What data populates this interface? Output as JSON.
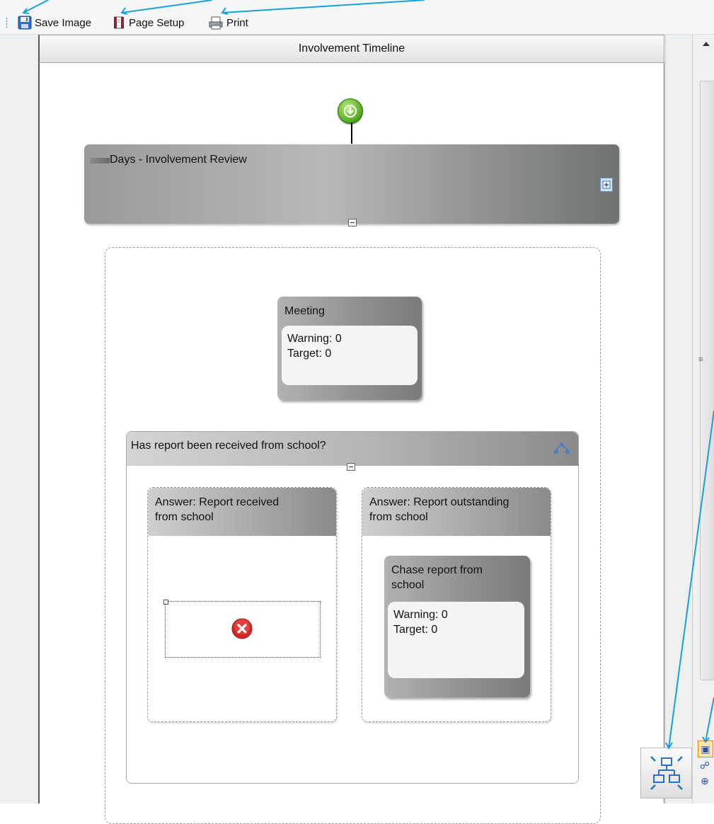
{
  "toolbar": {
    "save_image": "Save Image",
    "page_setup": "Page Setup",
    "print": "Print"
  },
  "canvas": {
    "title": "Involvement Timeline"
  },
  "activity": {
    "label": "Days - Involvement Review"
  },
  "meeting": {
    "title": "Meeting",
    "warning": "Warning: 0",
    "target": "Target: 0"
  },
  "decision": {
    "title": "Has report been received from school?",
    "branches": [
      {
        "line1": "Answer: Report received",
        "line2": "from school"
      },
      {
        "line1": "Answer: Report outstanding",
        "line2": "from school"
      }
    ]
  },
  "chase": {
    "line1": "Chase report from",
    "line2": "school",
    "warning": "Warning: 0",
    "target": "Target: 0"
  },
  "colors": {
    "annotation": "#1aa0d8",
    "start_node": "#4fa51c",
    "error": "#d42626"
  },
  "icons": [
    "save-icon",
    "page-setup-icon",
    "print-icon",
    "start-icon",
    "expand-icon",
    "collapse-icon",
    "branch-layout-icon",
    "error-icon",
    "overview-icon"
  ]
}
